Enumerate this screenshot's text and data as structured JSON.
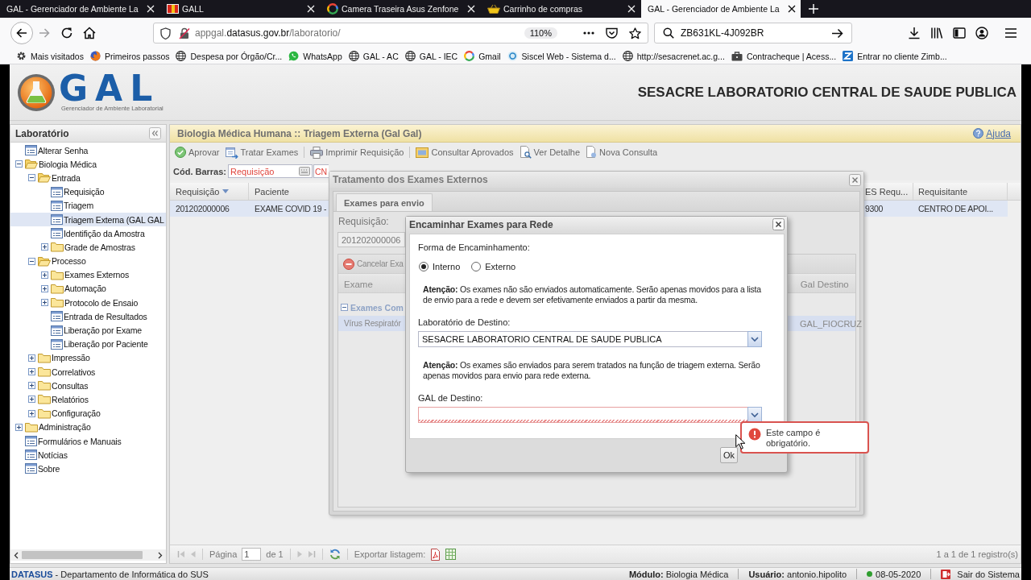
{
  "browser": {
    "tabs": [
      {
        "title": "GAL - Gerenciador de Ambiente La",
        "kind": "plain",
        "selected": false
      },
      {
        "title": "GALL",
        "kind": "flag",
        "selected": false
      },
      {
        "title": "Camera Traseira Asus Zenfone",
        "kind": "ring",
        "selected": false
      },
      {
        "title": "Carrinho de compras",
        "kind": "basket",
        "selected": false
      },
      {
        "title": "GAL - Gerenciador de Ambiente La",
        "kind": "plain",
        "selected": true
      }
    ],
    "address": "appgal.**datasus.gov.br**/laboratorio/",
    "zoom": "110%",
    "search": "ZB631KL-4J092BR",
    "bookmarks": [
      {
        "label": "Mais visitados",
        "kind": "gear"
      },
      {
        "label": "Primeiros passos",
        "kind": "browser"
      },
      {
        "label": "Despesa por Órgão/Cr...",
        "kind": "globe"
      },
      {
        "label": "WhatsApp",
        "kind": "chat"
      },
      {
        "label": "GAL - AC",
        "kind": "globe"
      },
      {
        "label": "GAL - IEC",
        "kind": "globe"
      },
      {
        "label": "Gmail",
        "kind": "ring"
      },
      {
        "label": "Siscel Web - Sistema d...",
        "kind": "swirl"
      },
      {
        "label": "http://sesacrenet.ac.g...",
        "kind": "globe"
      },
      {
        "label": "Contracheque | Acess...",
        "kind": "case"
      },
      {
        "label": "Entrar no cliente Zimb...",
        "kind": "tile"
      }
    ]
  },
  "header": {
    "logo": "GAL",
    "logo_subtitle": "Gerenciador de Ambiente Laboratorial",
    "title": "SESACRE LABORATORIO CENTRAL DE SAUDE PUBLICA"
  },
  "sidebar": {
    "title": "Laboratório",
    "items": [
      {
        "label": "Alterar Senha",
        "kind": "leaf",
        "selected": false
      },
      {
        "label": "Biologia Médica",
        "kind": "folder",
        "expanded": true,
        "selected": false,
        "children": [
          {
            "label": "Entrada",
            "kind": "folder",
            "expanded": true,
            "selected": false,
            "children": [
              {
                "label": "Requisição",
                "kind": "leaf",
                "selected": false
              },
              {
                "label": "Triagem",
                "kind": "leaf",
                "selected": false
              },
              {
                "label": "Triagem Externa (GAL GAL",
                "kind": "leaf",
                "selected": true
              },
              {
                "label": "Identifição da Amostra",
                "kind": "leaf",
                "selected": false
              },
              {
                "label": "Grade de Amostras",
                "kind": "folder",
                "expanded": false,
                "selected": false
              }
            ]
          },
          {
            "label": "Processo",
            "kind": "folder",
            "expanded": true,
            "selected": false,
            "children": [
              {
                "label": "Exames Externos",
                "kind": "folder",
                "expanded": false,
                "selected": false
              },
              {
                "label": "Automação",
                "kind": "folder",
                "expanded": false,
                "selected": false
              },
              {
                "label": "Protocolo de Ensaio",
                "kind": "folder",
                "expanded": false,
                "selected": false
              },
              {
                "label": "Entrada de Resultados",
                "kind": "leaf",
                "selected": false
              },
              {
                "label": "Liberação por Exame",
                "kind": "leaf",
                "selected": false
              },
              {
                "label": "Liberação por Paciente",
                "kind": "leaf",
                "selected": false
              }
            ]
          },
          {
            "label": "Impressão",
            "kind": "folder",
            "expanded": false,
            "selected": false
          },
          {
            "label": "Correlativos",
            "kind": "folder",
            "expanded": false,
            "selected": false
          },
          {
            "label": "Consultas",
            "kind": "folder",
            "expanded": false,
            "selected": false
          },
          {
            "label": "Relatórios",
            "kind": "folder",
            "expanded": false,
            "selected": false
          },
          {
            "label": "Configuração",
            "kind": "folder",
            "expanded": false,
            "selected": false
          }
        ]
      },
      {
        "label": "Administração",
        "kind": "folder",
        "expanded": false,
        "selected": false
      },
      {
        "label": "Formulários e Manuais",
        "kind": "leaf",
        "selected": false
      },
      {
        "label": "Notícias",
        "kind": "leaf",
        "selected": false
      },
      {
        "label": "Sobre",
        "kind": "leaf",
        "selected": false
      }
    ]
  },
  "main": {
    "title": "Biologia Médica Humana :: Triagem Externa (Gal Gal)",
    "help": "Ajuda",
    "toolbar": [
      {
        "buttons": [
          {
            "label": "Aprovar",
            "kind": "approve"
          },
          {
            "label": "Tratar Exames",
            "kind": "treat"
          }
        ]
      },
      {
        "buttons": [
          {
            "label": "Imprimir Requisição",
            "kind": "print"
          }
        ]
      },
      {
        "buttons": [
          {
            "label": "Consultar Aprovados",
            "kind": "query"
          },
          {
            "label": "Ver Detalhe",
            "kind": "detail"
          },
          {
            "label": "Nova Consulta",
            "kind": "new"
          }
        ]
      }
    ],
    "barcode": {
      "label": "Cód. Barras:",
      "fields": [
        {
          "placeholder": "Requisição",
          "kind": "keypad"
        },
        {
          "placeholder": "CN",
          "kind": "plain"
        }
      ]
    },
    "table": {
      "columns": [
        {
          "label": "Requisição",
          "sorted": true
        },
        {
          "label": "Paciente",
          "sorted": false
        },
        {
          "label": "ES Requ...",
          "sorted": false
        },
        {
          "label": "Requisitante",
          "sorted": false
        }
      ],
      "rows": [
        {
          "cells": [
            "201202000006",
            "EXAME COVID 19 -",
            "9300",
            "CENTRO DE APOI..."
          ],
          "selected": true
        }
      ]
    },
    "paging": {
      "page_label": "Página",
      "page": "1",
      "page_count": "de 1",
      "export_label": "Exportar listagem:",
      "summary": "1 a 1 de 1 registro(s)"
    }
  },
  "treatment_dialog": {
    "title": "Tratamento dos Exames Externos",
    "tabs": [
      {
        "label": "Exames para envio",
        "selected": true
      }
    ],
    "requisition_label": "Requisição:",
    "requisition_value": "201202000006",
    "toolbar": [
      {
        "label": "Cancelar Exa",
        "kind": "cancel"
      }
    ],
    "table": {
      "columns": [
        {
          "label": "Exame"
        },
        {
          "label": "Gal Destino"
        }
      ],
      "groups": [
        {
          "label": "Exames Com",
          "expanded": true,
          "rows": [
            {
              "cells": [
                "Vírus Respiratór",
                "GAL_FIOCRUZ"
              ],
              "selected": true
            }
          ]
        }
      ]
    }
  },
  "forward_dialog": {
    "title": "Encaminhar Exames para Rede",
    "mode_label": "Forma de Encaminhamento:",
    "modes": [
      {
        "label": "Interno",
        "selected": true
      },
      {
        "label": "Externo",
        "selected": false
      }
    ],
    "sections": [
      {
        "notice": "**Atenção:** Os exames não são enviados automaticamente. Serão apenas movidos para a lista de envio para a rede e devem ser efetivamente enviados a partir da mesma.",
        "field": {
          "label": "Laboratório de Destino:",
          "value": "SESACRE LABORATORIO CENTRAL DE SAUDE PUBLICA",
          "invalid": false
        }
      },
      {
        "notice": "**Atenção:** Os exames são enviados para serem tratados na função de triagem externa. Serão apenas movidos para envio para rede externa.",
        "field": {
          "label": "GAL de Destino:",
          "invalid": true,
          "error": "Este campo é obrigatório."
        }
      }
    ],
    "buttons": [
      {
        "label": "Ok"
      }
    ]
  },
  "status_bar": {
    "text": "**DATASUS** - Departamento de Informática do SUS",
    "module": "**Módulo:** Biologia Médica",
    "user": "**Usuário:** antonio.hipolito",
    "date": "08-05-2020",
    "logout": "Sair do Sistema"
  }
}
